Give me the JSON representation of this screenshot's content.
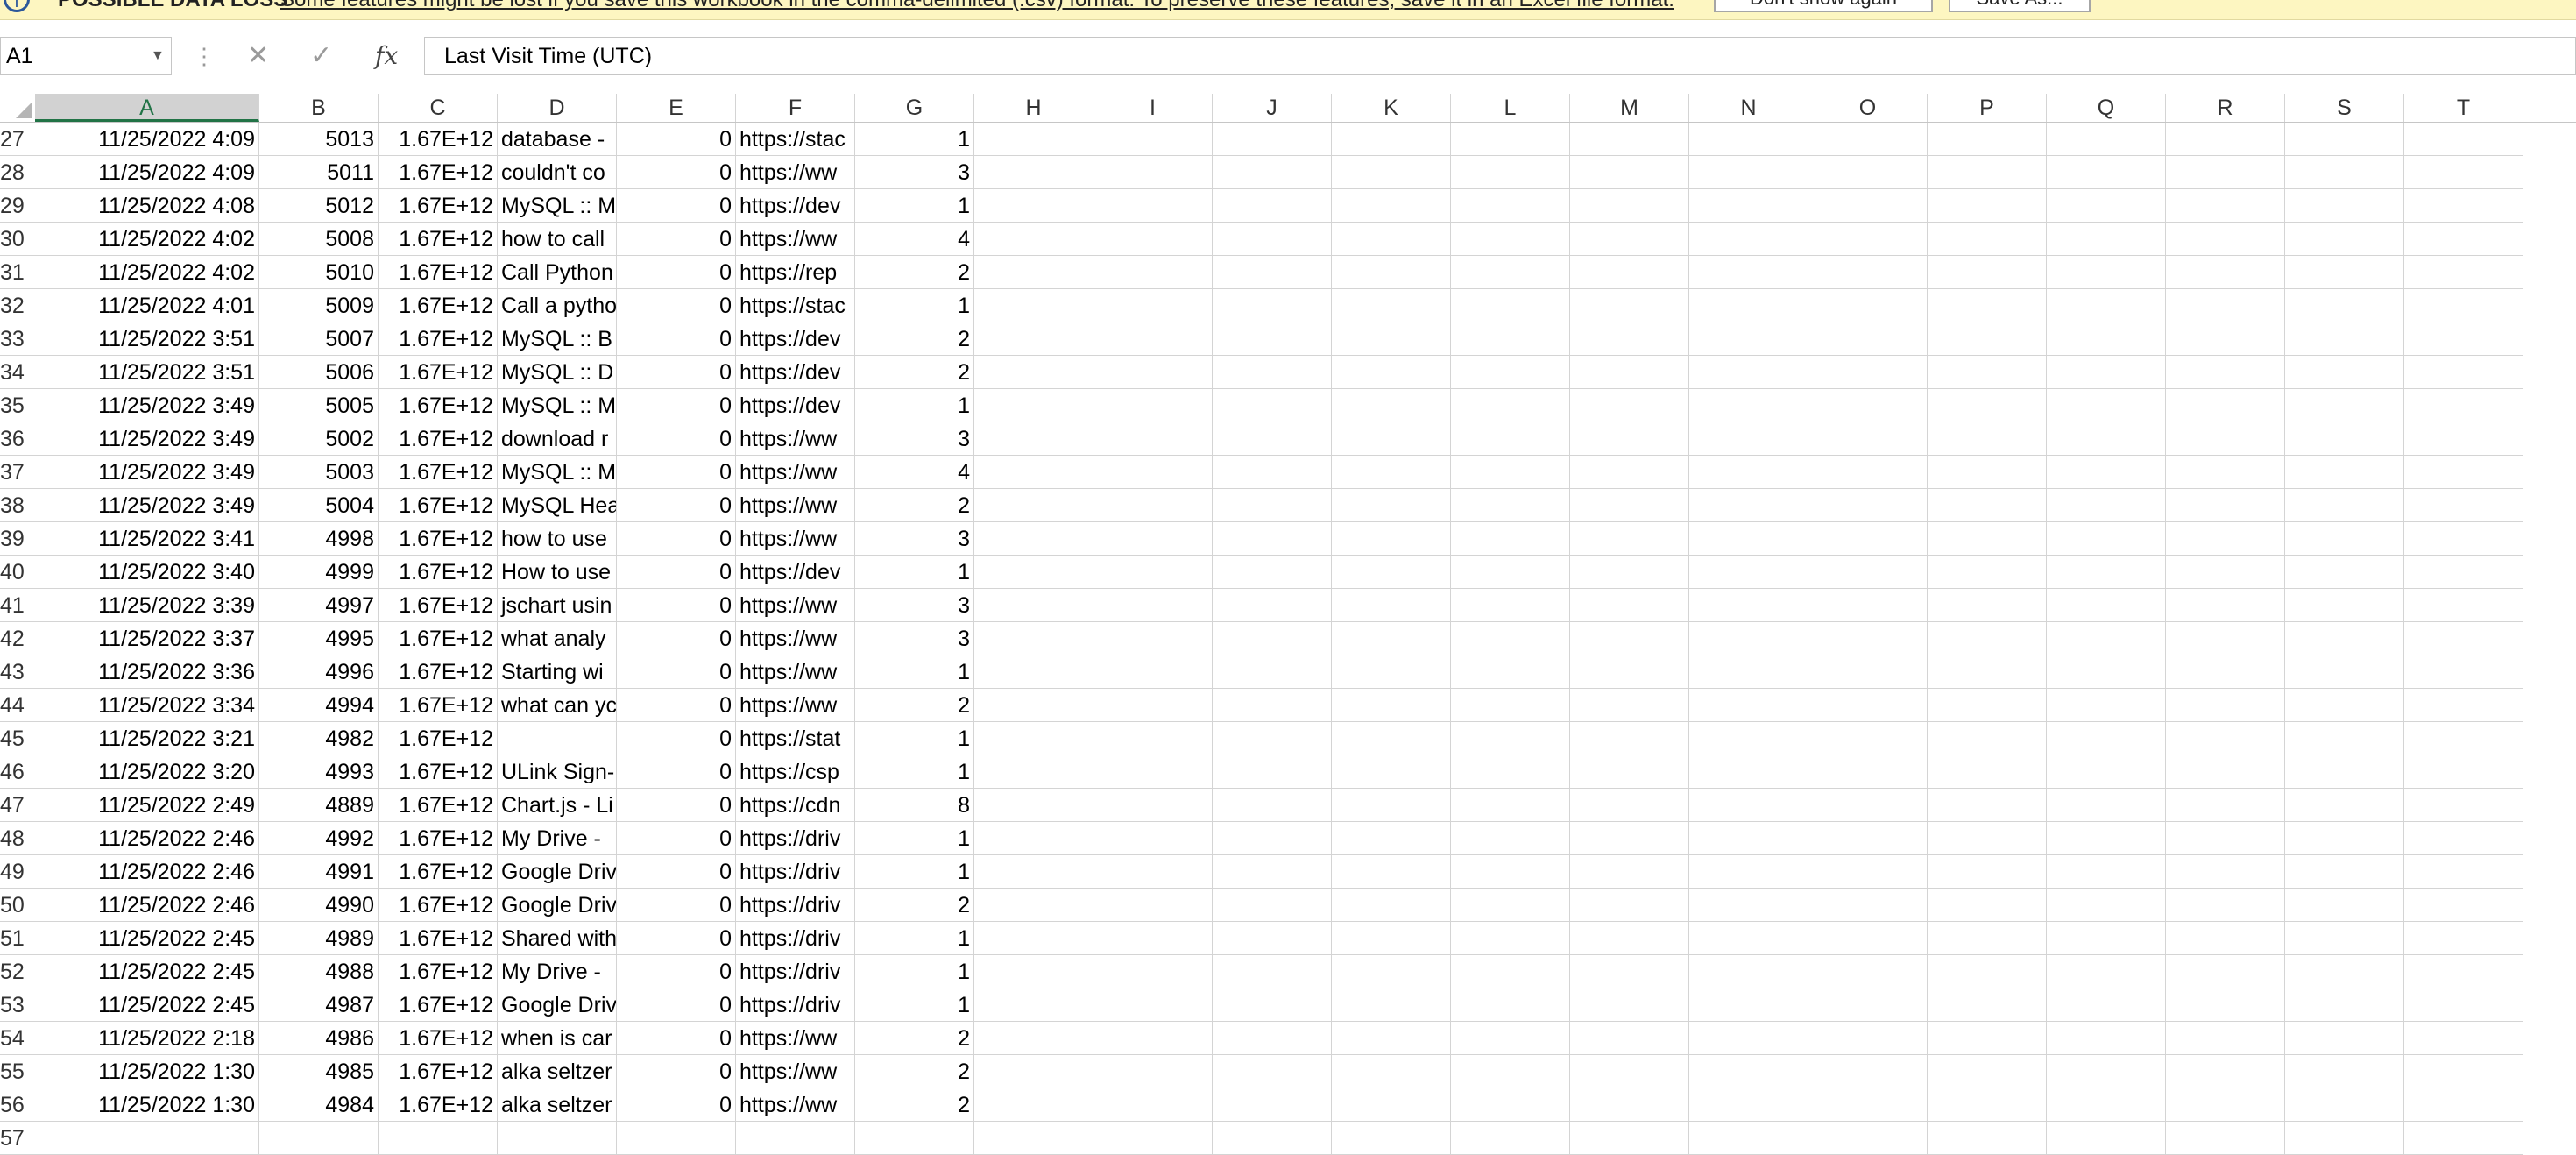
{
  "infobar": {
    "title": "POSSIBLE DATA LOSS",
    "message": "Some features might be lost if you save this workbook in the comma-delimited (.csv) format. To preserve these features, save it in an Excel file format.",
    "dont_show": "Don't show again",
    "save_as": "Save As..."
  },
  "formula_bar": {
    "name_box": "A1",
    "formula": "Last Visit Time (UTC)"
  },
  "columns": [
    "A",
    "B",
    "C",
    "D",
    "E",
    "F",
    "G",
    "H",
    "I",
    "J",
    "K",
    "L",
    "M",
    "N",
    "O",
    "P",
    "Q",
    "R",
    "S",
    "T"
  ],
  "selected_column": "A",
  "rows": [
    {
      "n": "27",
      "a": "11/25/2022 4:09",
      "b": "5013",
      "c": "1.67E+12",
      "d": "database -",
      "e": "0",
      "f": "https://stac",
      "g": "1"
    },
    {
      "n": "28",
      "a": "11/25/2022 4:09",
      "b": "5011",
      "c": "1.67E+12",
      "d": "couldn't co",
      "e": "0",
      "f": "https://ww",
      "g": "3"
    },
    {
      "n": "29",
      "a": "11/25/2022 4:08",
      "b": "5012",
      "c": "1.67E+12",
      "d": "MySQL :: M",
      "e": "0",
      "f": "https://dev",
      "g": "1"
    },
    {
      "n": "30",
      "a": "11/25/2022 4:02",
      "b": "5008",
      "c": "1.67E+12",
      "d": "how to call",
      "e": "0",
      "f": "https://ww",
      "g": "4"
    },
    {
      "n": "31",
      "a": "11/25/2022 4:02",
      "b": "5010",
      "c": "1.67E+12",
      "d": "Call Python",
      "e": "0",
      "f": "https://rep",
      "g": "2"
    },
    {
      "n": "32",
      "a": "11/25/2022 4:01",
      "b": "5009",
      "c": "1.67E+12",
      "d": "Call a pytho",
      "e": "0",
      "f": "https://stac",
      "g": "1"
    },
    {
      "n": "33",
      "a": "11/25/2022 3:51",
      "b": "5007",
      "c": "1.67E+12",
      "d": "MySQL :: B",
      "e": "0",
      "f": "https://dev",
      "g": "2"
    },
    {
      "n": "34",
      "a": "11/25/2022 3:51",
      "b": "5006",
      "c": "1.67E+12",
      "d": "MySQL :: D",
      "e": "0",
      "f": "https://dev",
      "g": "2"
    },
    {
      "n": "35",
      "a": "11/25/2022 3:49",
      "b": "5005",
      "c": "1.67E+12",
      "d": "MySQL :: M",
      "e": "0",
      "f": "https://dev",
      "g": "1"
    },
    {
      "n": "36",
      "a": "11/25/2022 3:49",
      "b": "5002",
      "c": "1.67E+12",
      "d": "download r",
      "e": "0",
      "f": "https://ww",
      "g": "3"
    },
    {
      "n": "37",
      "a": "11/25/2022 3:49",
      "b": "5003",
      "c": "1.67E+12",
      "d": "MySQL :: M",
      "e": "0",
      "f": "https://ww",
      "g": "4"
    },
    {
      "n": "38",
      "a": "11/25/2022 3:49",
      "b": "5004",
      "c": "1.67E+12",
      "d": "MySQL Hea",
      "e": "0",
      "f": "https://ww",
      "g": "2"
    },
    {
      "n": "39",
      "a": "11/25/2022 3:41",
      "b": "4998",
      "c": "1.67E+12",
      "d": "how to use",
      "e": "0",
      "f": "https://ww",
      "g": "3"
    },
    {
      "n": "40",
      "a": "11/25/2022 3:40",
      "b": "4999",
      "c": "1.67E+12",
      "d": "How to use",
      "e": "0",
      "f": "https://dev",
      "g": "1"
    },
    {
      "n": "41",
      "a": "11/25/2022 3:39",
      "b": "4997",
      "c": "1.67E+12",
      "d": "jschart usin",
      "e": "0",
      "f": "https://ww",
      "g": "3"
    },
    {
      "n": "42",
      "a": "11/25/2022 3:37",
      "b": "4995",
      "c": "1.67E+12",
      "d": "what analy",
      "e": "0",
      "f": "https://ww",
      "g": "3"
    },
    {
      "n": "43",
      "a": "11/25/2022 3:36",
      "b": "4996",
      "c": "1.67E+12",
      "d": "Starting wi",
      "e": "0",
      "f": "https://ww",
      "g": "1"
    },
    {
      "n": "44",
      "a": "11/25/2022 3:34",
      "b": "4994",
      "c": "1.67E+12",
      "d": "what can yc",
      "e": "0",
      "f": "https://ww",
      "g": "2"
    },
    {
      "n": "45",
      "a": "11/25/2022 3:21",
      "b": "4982",
      "c": "1.67E+12",
      "d": "",
      "e": "0",
      "f": "https://stat",
      "g": "1"
    },
    {
      "n": "46",
      "a": "11/25/2022 3:20",
      "b": "4993",
      "c": "1.67E+12",
      "d": "ULink Sign-",
      "e": "0",
      "f": "https://csp",
      "g": "1"
    },
    {
      "n": "47",
      "a": "11/25/2022 2:49",
      "b": "4889",
      "c": "1.67E+12",
      "d": "Chart.js - Li",
      "e": "0",
      "f": "https://cdn",
      "g": "8"
    },
    {
      "n": "48",
      "a": "11/25/2022 2:46",
      "b": "4992",
      "c": "1.67E+12",
      "d": "My Drive -",
      "e": "0",
      "f": "https://driv",
      "g": "1"
    },
    {
      "n": "49",
      "a": "11/25/2022 2:46",
      "b": "4991",
      "c": "1.67E+12",
      "d": "Google Driv",
      "e": "0",
      "f": "https://driv",
      "g": "1"
    },
    {
      "n": "50",
      "a": "11/25/2022 2:46",
      "b": "4990",
      "c": "1.67E+12",
      "d": "Google Driv",
      "e": "0",
      "f": "https://driv",
      "g": "2"
    },
    {
      "n": "51",
      "a": "11/25/2022 2:45",
      "b": "4989",
      "c": "1.67E+12",
      "d": "Shared with",
      "e": "0",
      "f": "https://driv",
      "g": "1"
    },
    {
      "n": "52",
      "a": "11/25/2022 2:45",
      "b": "4988",
      "c": "1.67E+12",
      "d": "My Drive -",
      "e": "0",
      "f": "https://driv",
      "g": "1"
    },
    {
      "n": "53",
      "a": "11/25/2022 2:45",
      "b": "4987",
      "c": "1.67E+12",
      "d": "Google Driv",
      "e": "0",
      "f": "https://driv",
      "g": "1"
    },
    {
      "n": "54",
      "a": "11/25/2022 2:18",
      "b": "4986",
      "c": "1.67E+12",
      "d": "when is car",
      "e": "0",
      "f": "https://ww",
      "g": "2"
    },
    {
      "n": "55",
      "a": "11/25/2022 1:30",
      "b": "4985",
      "c": "1.67E+12",
      "d": "alka seltzer",
      "e": "0",
      "f": "https://ww",
      "g": "2"
    },
    {
      "n": "56",
      "a": "11/25/2022 1:30",
      "b": "4984",
      "c": "1.67E+12",
      "d": "alka seltzer",
      "e": "0",
      "f": "https://ww",
      "g": "2"
    },
    {
      "n": "57",
      "a": "",
      "b": "",
      "c": "",
      "d": "",
      "e": "",
      "f": "",
      "g": ""
    }
  ]
}
